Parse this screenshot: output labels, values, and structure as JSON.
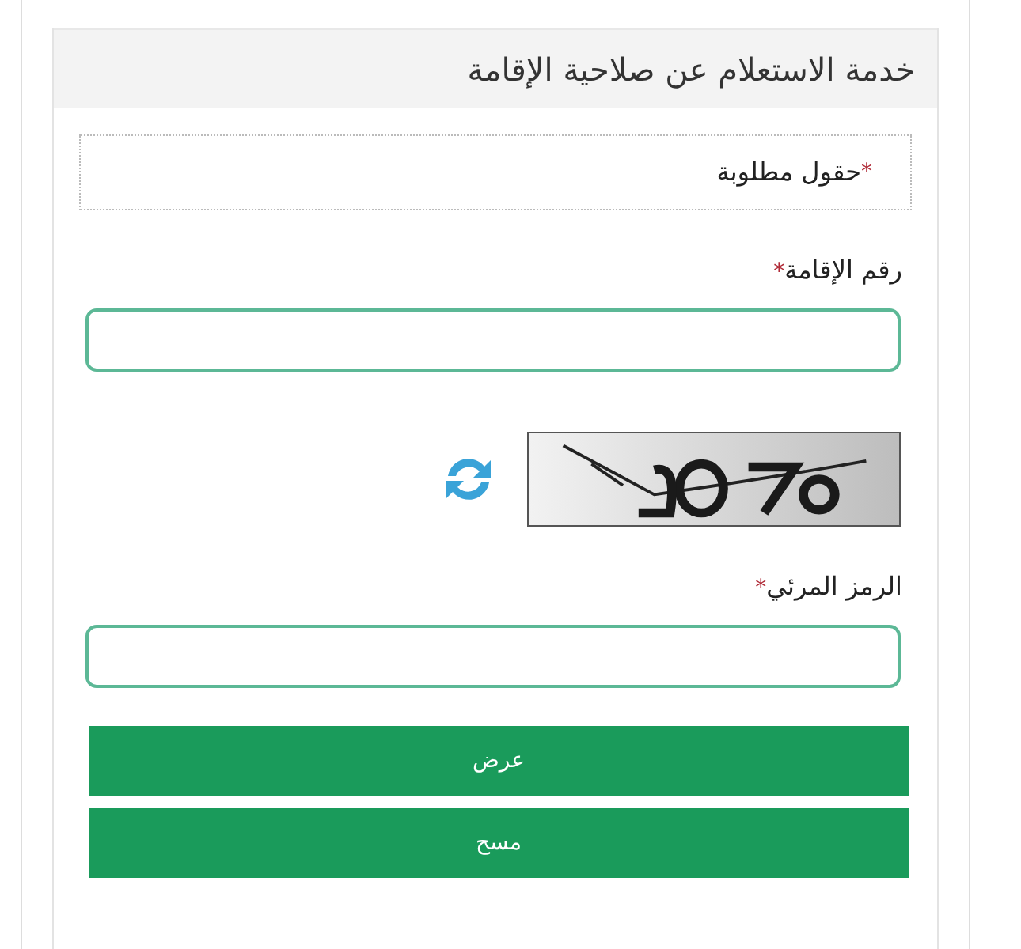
{
  "panel": {
    "title": "خدمة الاستعلام عن صلاحية الإقامة"
  },
  "required_note": {
    "mark": "*",
    "text": "حقول مطلوبة"
  },
  "fields": [
    {
      "kind": "text",
      "label": "رقم الإقامة",
      "mark": "*"
    },
    {
      "kind": "captcha"
    },
    {
      "kind": "text",
      "label": "الرمز المرئي",
      "mark": "*"
    }
  ],
  "buttons": [
    "عرض",
    "مسح"
  ]
}
